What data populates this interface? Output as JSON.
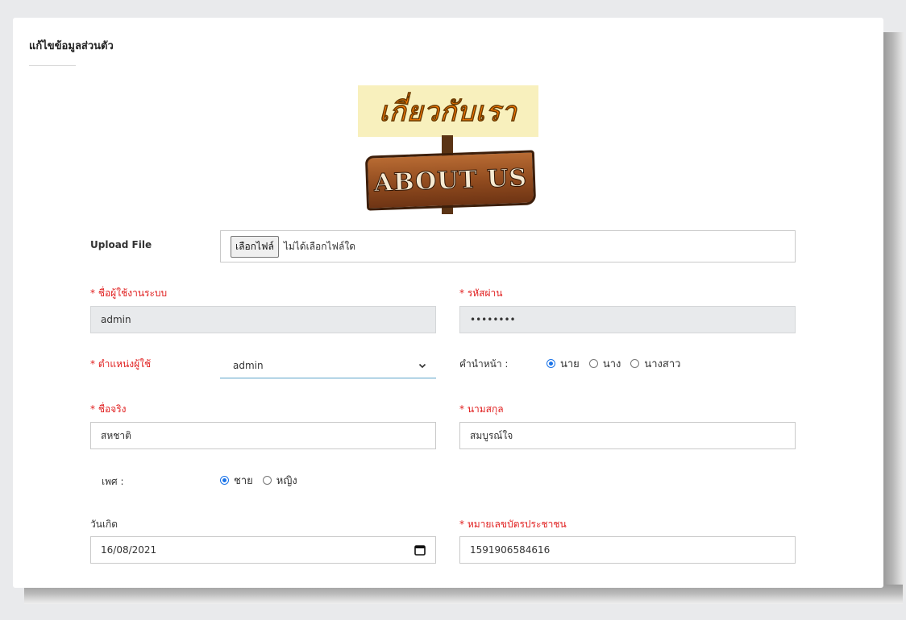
{
  "page": {
    "title": "แก้ไขข้อมูลส่วนตัว"
  },
  "logo": {
    "thai_text": "เกี่ยวกับเรา",
    "english_text": "ABOUT US"
  },
  "upload": {
    "label": "Upload File",
    "button_label": "เลือกไฟล์",
    "status": "ไม่ได้เลือกไฟล์ใด"
  },
  "form": {
    "required_mark": "*",
    "username": {
      "label": "ชื่อผู้ใช้งานระบบ",
      "value": "admin"
    },
    "password": {
      "label": "รหัสผ่าน",
      "value": "••••••••"
    },
    "role": {
      "label": "ตำแหน่งผู้ใช้",
      "selected": "admin"
    },
    "title_prefix": {
      "label": "คำนำหน้า :",
      "options": [
        "นาย",
        "นาง",
        "นางสาว"
      ],
      "selected_index": 0
    },
    "first_name": {
      "label": "ชื่อจริง",
      "value": "สหชาติ"
    },
    "last_name": {
      "label": "นามสกุล",
      "value": "สมบูรณ์ใจ"
    },
    "gender": {
      "label": "เพศ :",
      "options": [
        "ชาย",
        "หญิง"
      ],
      "selected_index": 0
    },
    "birthdate": {
      "label": "วันเกิด",
      "value": "16/08/2021"
    },
    "citizen_id": {
      "label": "หมายเลขบัตรประชาชน",
      "value": "1591906584616"
    }
  },
  "colors": {
    "required": "#e01d1d",
    "radio_accent": "#1a73e8",
    "select_underline": "#5ba3c9",
    "readonly_bg": "#e8eaec"
  }
}
